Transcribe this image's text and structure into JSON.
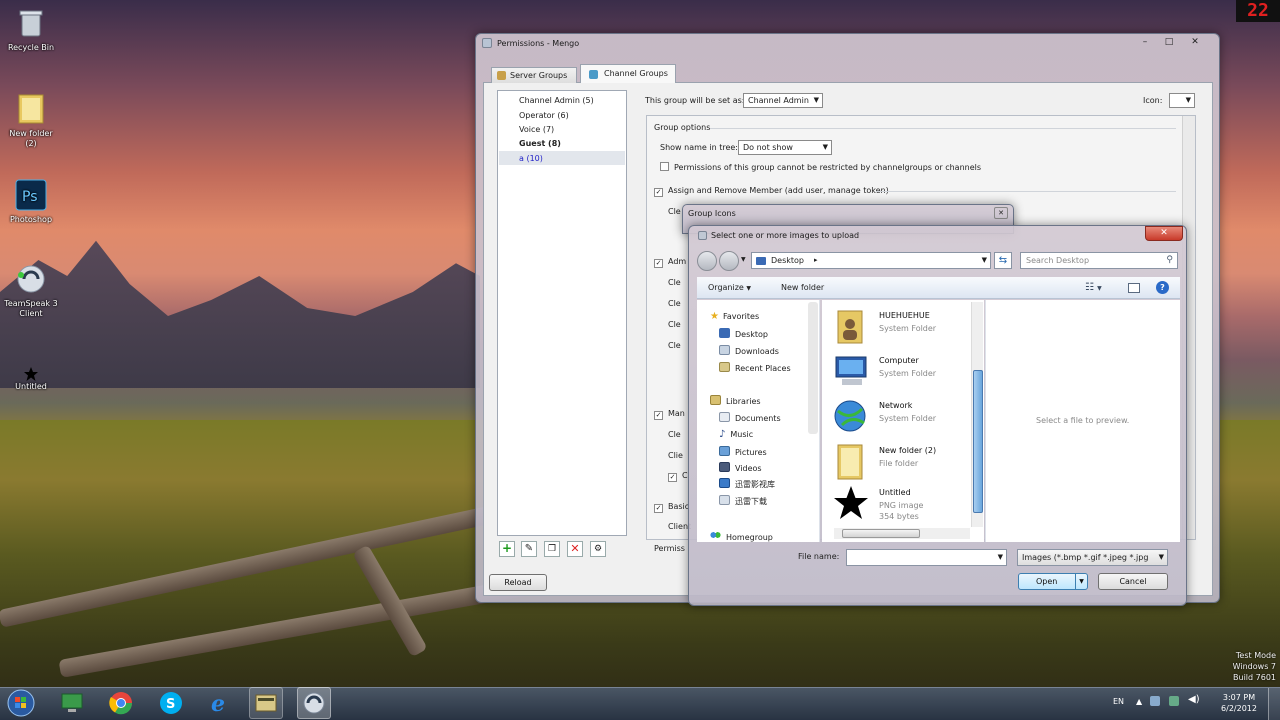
{
  "desktop": {
    "icons": [
      {
        "label": "Recycle Bin",
        "icon": "recycle-bin-icon"
      },
      {
        "label": "New folder\n(2)",
        "icon": "folder-icon"
      },
      {
        "label": "Photoshop",
        "icon": "photoshop-icon"
      },
      {
        "label": "TeamSpeak 3\nClient",
        "icon": "teamspeak-icon"
      },
      {
        "label": "Untitled",
        "icon": "star-icon"
      }
    ],
    "clock_overlay": "22",
    "watermark": [
      "Test Mode",
      "Windows 7",
      "Build 7601"
    ]
  },
  "permissions": {
    "title": "Permissions - Mengo",
    "tabs": [
      "Server Groups",
      "Channel Groups"
    ],
    "groups": [
      "Channel Admin (5)",
      "Operator (6)",
      "Voice (7)",
      "Guest (8)",
      "a (10)"
    ],
    "set_as_label": "This group will be set as:",
    "set_as_value": "Channel Admin",
    "icon_label": "Icon:",
    "group_options": "Group options",
    "show_name_label": "Show name in tree:",
    "show_name_value": "Do not show",
    "cannot_restrict": "Permissions of this group cannot be restricted by channelgroups or channels",
    "assign_remove": "Assign and Remove Member (add user, manage token)",
    "partial": {
      "cle": "Cle",
      "adm": "Adm",
      "clie": "Clie",
      "c": "C",
      "man": "Man",
      "basic": "Basic",
      "client": "Client",
      "permiss": "Permiss"
    },
    "reload": "Reload"
  },
  "group_icons": {
    "title": "Group Icons"
  },
  "file_dialog": {
    "title": "Select one or more images to upload",
    "location": "Desktop",
    "search_placeholder": "Search Desktop",
    "organize": "Organize",
    "new_folder": "New folder",
    "favorites": "Favorites",
    "fav_items": [
      "Desktop",
      "Downloads",
      "Recent Places"
    ],
    "libraries": "Libraries",
    "lib_items": [
      "Documents",
      "Music",
      "Pictures",
      "Videos",
      "迅雷影视库",
      "迅雷下载"
    ],
    "homegroup": "Homegroup",
    "files": [
      {
        "name": "HUEHUEHUE",
        "type": "System Folder",
        "extra": ""
      },
      {
        "name": "Computer",
        "type": "System Folder",
        "extra": ""
      },
      {
        "name": "Network",
        "type": "System Folder",
        "extra": ""
      },
      {
        "name": "New folder (2)",
        "type": "File folder",
        "extra": ""
      },
      {
        "name": "Untitled",
        "type": "PNG image",
        "extra": "354 bytes"
      }
    ],
    "preview": "Select a file to preview.",
    "file_name_label": "File name:",
    "file_name_value": "",
    "filter": "Images (*.bmp *.gif *.jpeg *.jpg",
    "open": "Open",
    "cancel": "Cancel"
  },
  "taskbar": {
    "lang": "EN",
    "time": "3:07 PM",
    "date": "6/2/2012"
  }
}
